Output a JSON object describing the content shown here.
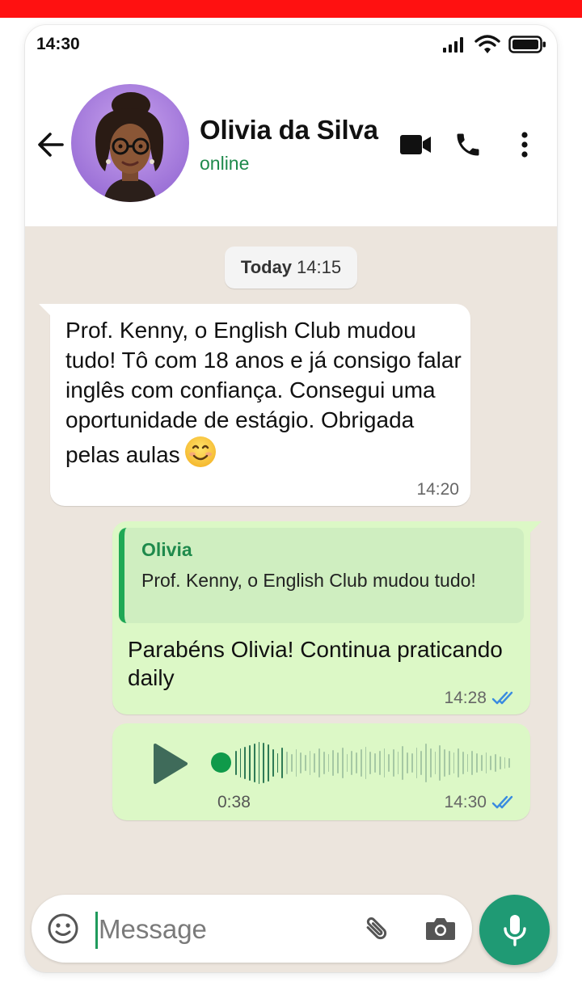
{
  "status_bar": {
    "time": "14:30",
    "icons": [
      "signal-icon",
      "wifi-icon",
      "battery-icon"
    ]
  },
  "header": {
    "contact_name": "Olivia da Silva",
    "presence": "online",
    "actions": [
      "video-call-icon",
      "voice-call-icon",
      "more-options-icon"
    ]
  },
  "chat": {
    "date_chip": {
      "day": "Today",
      "time": "14:15"
    },
    "messages": [
      {
        "direction": "incoming",
        "text": "Prof. Kenny, o English Club mudou tudo! Tô com 18 anos e já consigo falar inglês com confiança. Consegui uma oportunidade de estágio. Obrigada pelas aulas",
        "emoji": "smiling-face-icon",
        "time": "14:20"
      },
      {
        "direction": "outgoing",
        "quote": {
          "author": "Olivia",
          "text": "Prof. Kenny, o English Club mudou tudo!"
        },
        "text": "Parabéns Olivia! Continua praticando daily",
        "time": "14:28",
        "status": "read"
      },
      {
        "direction": "outgoing",
        "type": "voice",
        "duration": "0:38",
        "time": "14:30",
        "status": "read",
        "progress": 0.18
      }
    ]
  },
  "composer": {
    "placeholder": "Message"
  },
  "colors": {
    "brand_green": "#1f9a74",
    "outgoing_bubble": "#dcf8c6",
    "chat_background": "#ece5dd",
    "read_ticks": "#3a8be0",
    "top_bar": "#ff1111"
  }
}
